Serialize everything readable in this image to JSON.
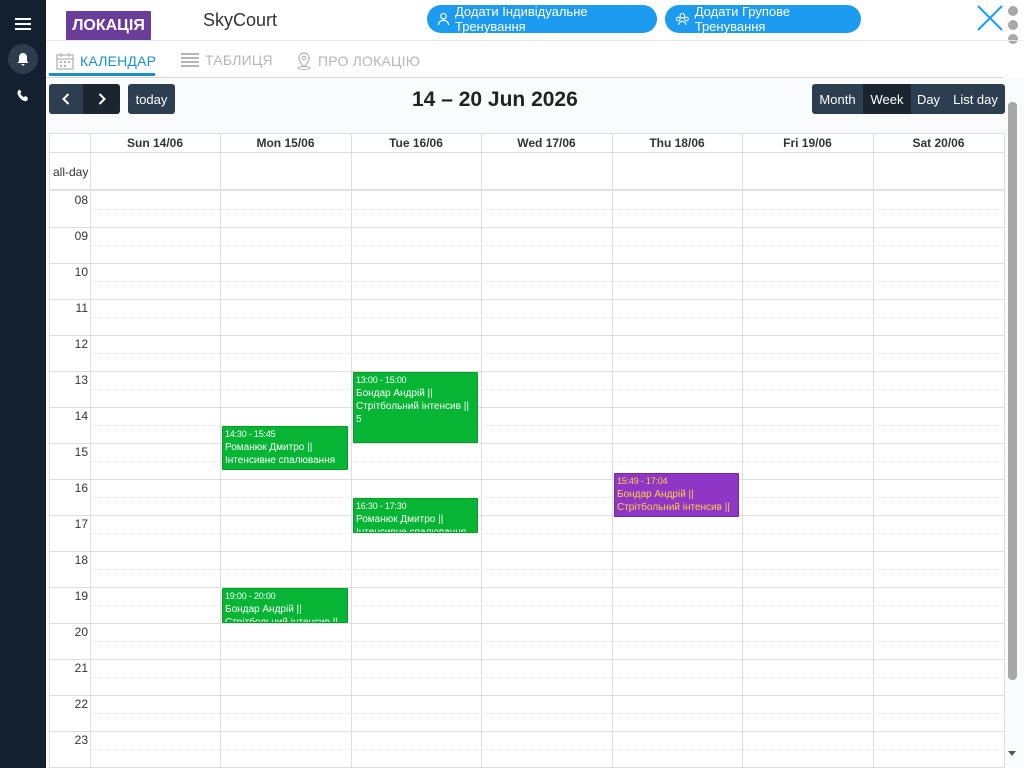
{
  "sidebar": {
    "items": [
      {
        "icon": "menu-icon"
      },
      {
        "icon": "bell-icon"
      },
      {
        "icon": "phone-icon"
      }
    ]
  },
  "header": {
    "location_badge": "ЛОКАЦІЯ",
    "location_name": "SkyCourt",
    "add_individual": "Додати Індивідуальне Тренування",
    "add_group": "Додати Групове Тренування"
  },
  "tabs": [
    {
      "label": "КАЛЕНДАР",
      "icon": "calendar-icon",
      "active": true
    },
    {
      "label": "ТАБЛИЦЯ",
      "icon": "table-icon",
      "active": false
    },
    {
      "label": "ПРО ЛОКАЦІЮ",
      "icon": "location-pin-icon",
      "active": false
    }
  ],
  "toolbar": {
    "today_label": "today",
    "title": "14 – 20 Jun 2026",
    "views": [
      "Month",
      "Week",
      "Day",
      "List day"
    ],
    "active_view": "Week"
  },
  "days": [
    "Sun 14/06",
    "Mon 15/06",
    "Tue 16/06",
    "Wed 17/06",
    "Thu 18/06",
    "Fri 19/06",
    "Sat 20/06"
  ],
  "allday_label": "all-day",
  "hours": [
    "08",
    "09",
    "10",
    "11",
    "12",
    "13",
    "14",
    "15",
    "16",
    "17",
    "18",
    "19",
    "20",
    "21",
    "22",
    "23"
  ],
  "events": [
    {
      "day": 2,
      "start": "13:00",
      "end": "15:00",
      "time": "13:00 - 15:00",
      "title": "Бондар Андрій || Стрітбольний інтенсив || 5",
      "color": "#06b533"
    },
    {
      "day": 1,
      "start": "14:30",
      "end": "15:45",
      "time": "14:30 - 15:45",
      "title": "Романюк Дмитро || Інтенсивне спалювання",
      "color": "#06b533"
    },
    {
      "day": 4,
      "start": "15:49",
      "end": "17:04",
      "time": "15:49 - 17:04",
      "title": "Бондар Андрій || Стрітбольний інтенсив ||",
      "color": "#9036c6"
    },
    {
      "day": 2,
      "start": "16:30",
      "end": "17:30",
      "time": "16:30 - 17:30",
      "title": "Романюк Дмитро || Інтенсивне спалювання",
      "color": "#06b533"
    },
    {
      "day": 1,
      "start": "19:00",
      "end": "20:00",
      "time": "19:00 - 20:00",
      "title": "Бондар Андрій || Стрітбольний інтенсив ||",
      "color": "#06b533"
    }
  ]
}
